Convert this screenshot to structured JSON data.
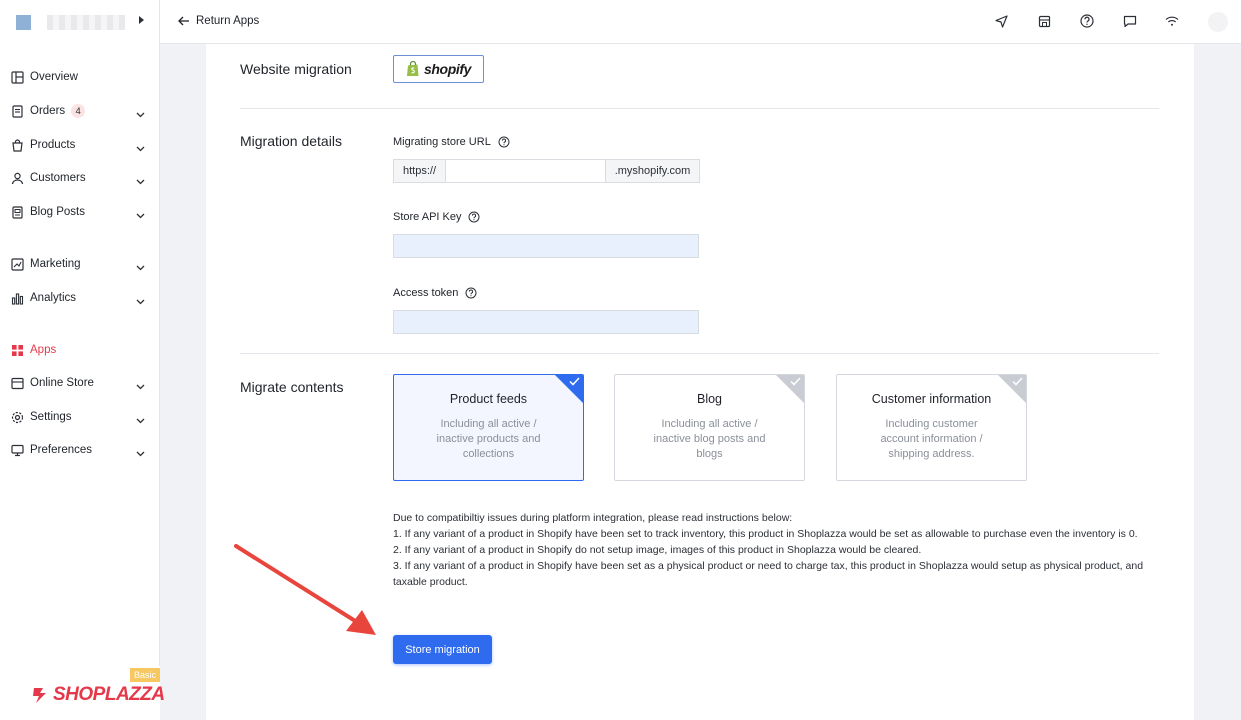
{
  "sidebar": {
    "items": [
      {
        "label": "Overview",
        "icon": "overview-icon"
      },
      {
        "label": "Orders",
        "icon": "orders-icon",
        "badge": "4"
      },
      {
        "label": "Products",
        "icon": "products-icon"
      },
      {
        "label": "Customers",
        "icon": "customers-icon"
      },
      {
        "label": "Blog Posts",
        "icon": "blog-posts-icon"
      },
      {
        "label": "Marketing",
        "icon": "marketing-icon"
      },
      {
        "label": "Analytics",
        "icon": "analytics-icon"
      },
      {
        "label": "Apps",
        "icon": "apps-icon",
        "active": true
      },
      {
        "label": "Online Store",
        "icon": "online-store-icon"
      },
      {
        "label": "Settings",
        "icon": "settings-icon"
      },
      {
        "label": "Preferences",
        "icon": "preferences-icon"
      }
    ],
    "plan_badge": "Basic",
    "brand": "SHOPLAZZA"
  },
  "topbar": {
    "back_label": "Return Apps",
    "icons": [
      "send-icon",
      "store-icon",
      "help-icon",
      "message-icon",
      "wifi-icon"
    ]
  },
  "sections": {
    "website_migration": {
      "label": "Website migration",
      "platform": "shopify"
    },
    "migration_details": {
      "label": "Migration details",
      "store_url_label": "Migrating store URL",
      "url_prefix": "https://",
      "url_suffix": ".myshopify.com",
      "api_key_label": "Store API Key",
      "access_token_label": "Access token"
    },
    "migrate_contents": {
      "label": "Migrate contents",
      "options": [
        {
          "title": "Product feeds",
          "desc": "Including all active / inactive products and collections",
          "selected": true
        },
        {
          "title": "Blog",
          "desc": "Including all active / inactive blog posts and blogs",
          "selected": false
        },
        {
          "title": "Customer information",
          "desc": "Including customer account information / shipping address.",
          "selected": false
        }
      ]
    }
  },
  "instructions": {
    "intro": "Due to compatibiltiy issues during platform integration, please read instructions below:",
    "lines": [
      "1. If any variant of a product in Shopify have been set to track inventory, this product in Shoplazza would be set as allowable to purchase even the inventory is 0.",
      "2. If any variant of a product in Shopify do not setup image, images of this product in Shoplazza would be cleared.",
      "3. If any variant of a product in Shopify have been set as a physical product or need to charge tax, this product in Shoplazza would setup as physical product, and taxable product."
    ]
  },
  "actions": {
    "migrate_label": "Store migration"
  },
  "colors": {
    "accent": "#2f6bef",
    "brand": "#e4394a",
    "annotation_arrow": "#e8453c"
  }
}
